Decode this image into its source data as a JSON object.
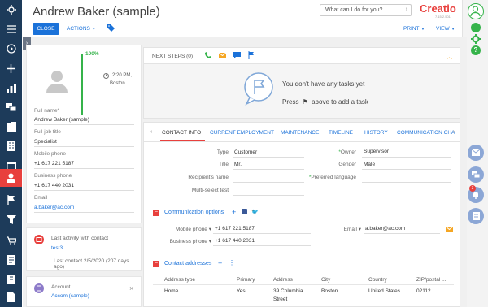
{
  "header": {
    "title": "Andrew Baker (sample)",
    "ask_placeholder": "What can I do for you?",
    "logo": "Creatio",
    "version": "7.15.2.501",
    "close_label": "CLOSE",
    "actions_label": "ACTIONS",
    "print_label": "PRINT",
    "view_label": "VIEW"
  },
  "profile": {
    "completeness": "100%",
    "time": "2:20 PM,",
    "city": "Boston",
    "fields": [
      {
        "label": "Full name*",
        "value": "Andrew Baker (sample)"
      },
      {
        "label": "Full job title",
        "value": "Specialist"
      },
      {
        "label": "Mobile phone",
        "value": "+1 617 221 5187"
      },
      {
        "label": "Business phone",
        "value": "+1 617 440 2031"
      },
      {
        "label": "Email",
        "value": "a.baker@ac.com"
      }
    ]
  },
  "activity": {
    "label": "Last activity with contact",
    "link": "test3",
    "last_contact": "Last contact 2/5/2020 (207 days ago)"
  },
  "account": {
    "label": "Account",
    "value": "Accom (sample)"
  },
  "next_steps": {
    "title": "NEXT STEPS (0)",
    "empty_line1": "You don't have any tasks yet",
    "empty_line2_a": "Press",
    "empty_line2_b": "above to add a task"
  },
  "tabs": [
    "CONTACT INFO",
    "CURRENT EMPLOYMENT",
    "MAINTENANCE",
    "TIMELINE",
    "HISTORY",
    "COMMUNICATION CHA"
  ],
  "contact_info": {
    "type_label": "Type",
    "type_value": "Customer",
    "title_label": "Title",
    "title_value": "Mr.",
    "recipient_label": "Recipient's name",
    "multiselect_label": "Multi-select test",
    "owner_label": "Owner",
    "owner_value": "Supervisor",
    "gender_label": "Gender",
    "gender_value": "Male",
    "language_label": "Preferred language"
  },
  "communication": {
    "section_title": "Communication options",
    "mobile_label": "Mobile phone",
    "mobile_value": "+1 617 221 5187",
    "business_label": "Business phone",
    "business_value": "+1 617 440 2031",
    "email_label": "Email",
    "email_value": "a.baker@ac.com"
  },
  "addresses": {
    "section_title": "Contact addresses",
    "columns": [
      "Address type",
      "Primary",
      "Address",
      "City",
      "Country",
      "ZIP/postal ..."
    ],
    "row": [
      "Home",
      "Yes",
      "39 Columbia",
      "Boston",
      "United States",
      "02112"
    ],
    "row_wrap": "Street"
  },
  "notifications": {
    "badge": "3"
  },
  "colors": {
    "accent": "#e8403d",
    "nav": "#1d3b5a",
    "link": "#1b72d9",
    "success": "#35b34a"
  }
}
